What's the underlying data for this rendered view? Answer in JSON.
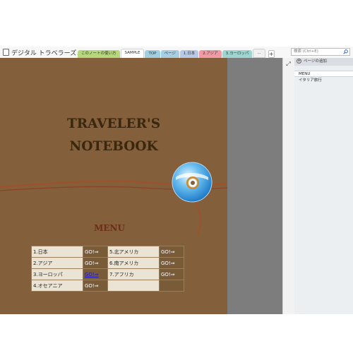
{
  "notebook": {
    "title": "デジタル トラベラーズノート"
  },
  "tabs": [
    {
      "label": "このノートの使い方",
      "color": "#b6d77c"
    },
    {
      "label": "SAMPLE",
      "color": "#ffffff",
      "active": true
    },
    {
      "label": "TOP",
      "color": "#9fcfe0"
    },
    {
      "label": "ページ",
      "color": "#a7cfe3"
    },
    {
      "label": "1.日本",
      "color": "#b7c9e6"
    },
    {
      "label": "2.アジア",
      "color": "#f09aa6"
    },
    {
      "label": "3.ヨーロッパ",
      "color": "#9dd6d0"
    },
    {
      "label": "...",
      "color": "#f0f0f0"
    }
  ],
  "add_tab_label": "+",
  "search": {
    "placeholder": "検索 (Ctrl+E)"
  },
  "cover": {
    "title_line1": "TRAVELER'S",
    "title_line2": "NOTEBOOK",
    "menu_heading": "MENU"
  },
  "menu_table": {
    "rows": [
      {
        "left_name": "1.日本",
        "left_go": "GO!⇒",
        "right_name": "5.北アメリカ",
        "right_go": "GO!⇒"
      },
      {
        "left_name": "2.アジア",
        "left_go": "GO!⇒",
        "right_name": "6.南アメリカ",
        "right_go": "GO!⇒"
      },
      {
        "left_name": "3.ヨーロッパ",
        "left_go": "GO!⇒",
        "right_name": "7.アフリカ",
        "right_go": "GO!⇒"
      },
      {
        "left_name": "4.オセアニア",
        "left_go": "GO!⇒",
        "right_name": "",
        "right_go": ""
      }
    ]
  },
  "pages_pane": {
    "add_page_label": "ページの追加",
    "items": [
      {
        "label": "MENU",
        "selected": true
      },
      {
        "label": "イタリア旅行",
        "selected": false
      }
    ]
  },
  "colors": {
    "cover_brown": "#835f3b",
    "title_dark_brown": "#3a270e",
    "menu_red_brown": "#6b2e1a",
    "strap_red": "#a2502a"
  },
  "icons": {
    "expand": "expand-icon",
    "search": "search-icon",
    "add_page": "plus-icon",
    "dropdown": "chevron-down-icon"
  }
}
